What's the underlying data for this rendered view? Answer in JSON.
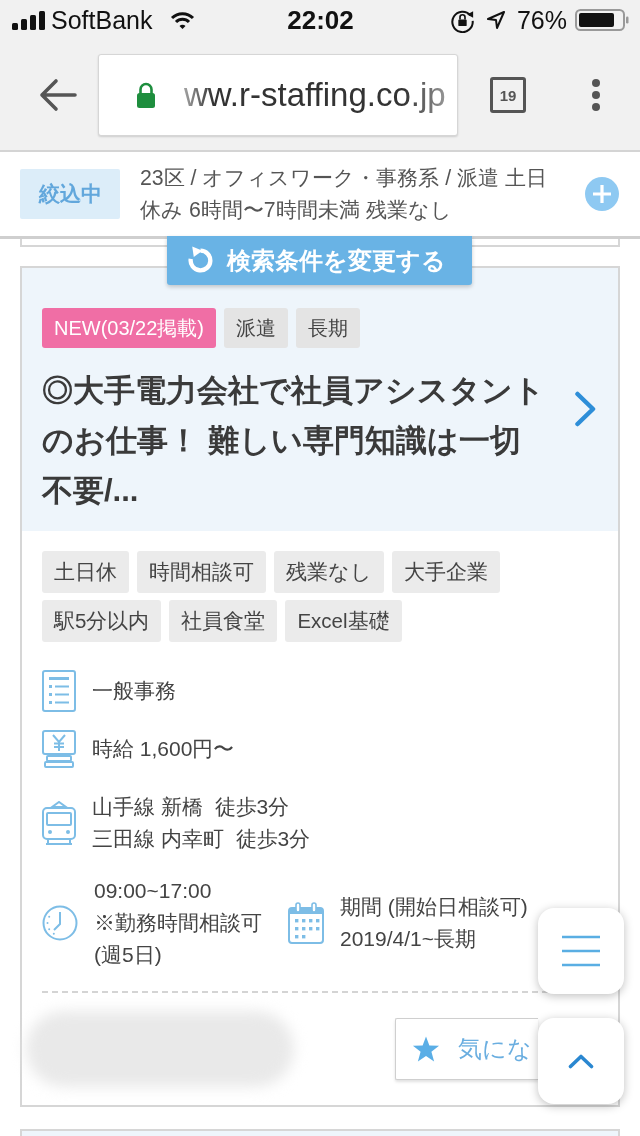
{
  "status_bar": {
    "carrier": "SoftBank",
    "time": "22:02",
    "battery": "76%"
  },
  "browser": {
    "url": "ww.r-staffing.co.jp",
    "tab_count": "19"
  },
  "filter": {
    "label": "絞込中",
    "conditions": "23区 / オフィスワーク・事務系 / 派遣 土日休み 6時間〜7時間未満 残業なし"
  },
  "change_search_button": "検索条件を変更する",
  "job": {
    "badges": [
      {
        "label": "NEW(03/22掲載)",
        "kind": "new"
      },
      {
        "label": "派遣",
        "kind": "plain"
      },
      {
        "label": "長期",
        "kind": "plain"
      }
    ],
    "title": "◎大手電力会社で社員アシスタントのお仕事！ 難しい専門知識は一切不要/...",
    "tags": [
      "土日休",
      "時間相談可",
      "残業なし",
      "大手企業",
      "駅5分以内",
      "社員食堂",
      "Excel基礎"
    ],
    "details": [
      {
        "kind": "job_type",
        "lines": [
          "一般事務"
        ]
      },
      {
        "kind": "wage",
        "lines": [
          "時給 1,600円〜"
        ]
      },
      {
        "kind": "access",
        "lines": [
          "山手線 新橋  徒歩3分",
          "三田線 内幸町  徒歩3分"
        ]
      }
    ],
    "schedule": [
      {
        "kind": "hours",
        "lines": [
          "09:00~17:00",
          "※勤務時間相談可",
          "(週5日)"
        ]
      },
      {
        "kind": "period",
        "lines": [
          "期間 (開始日相談可)",
          "2019/4/1~長期"
        ]
      }
    ],
    "favorite_button": "気にな"
  }
}
